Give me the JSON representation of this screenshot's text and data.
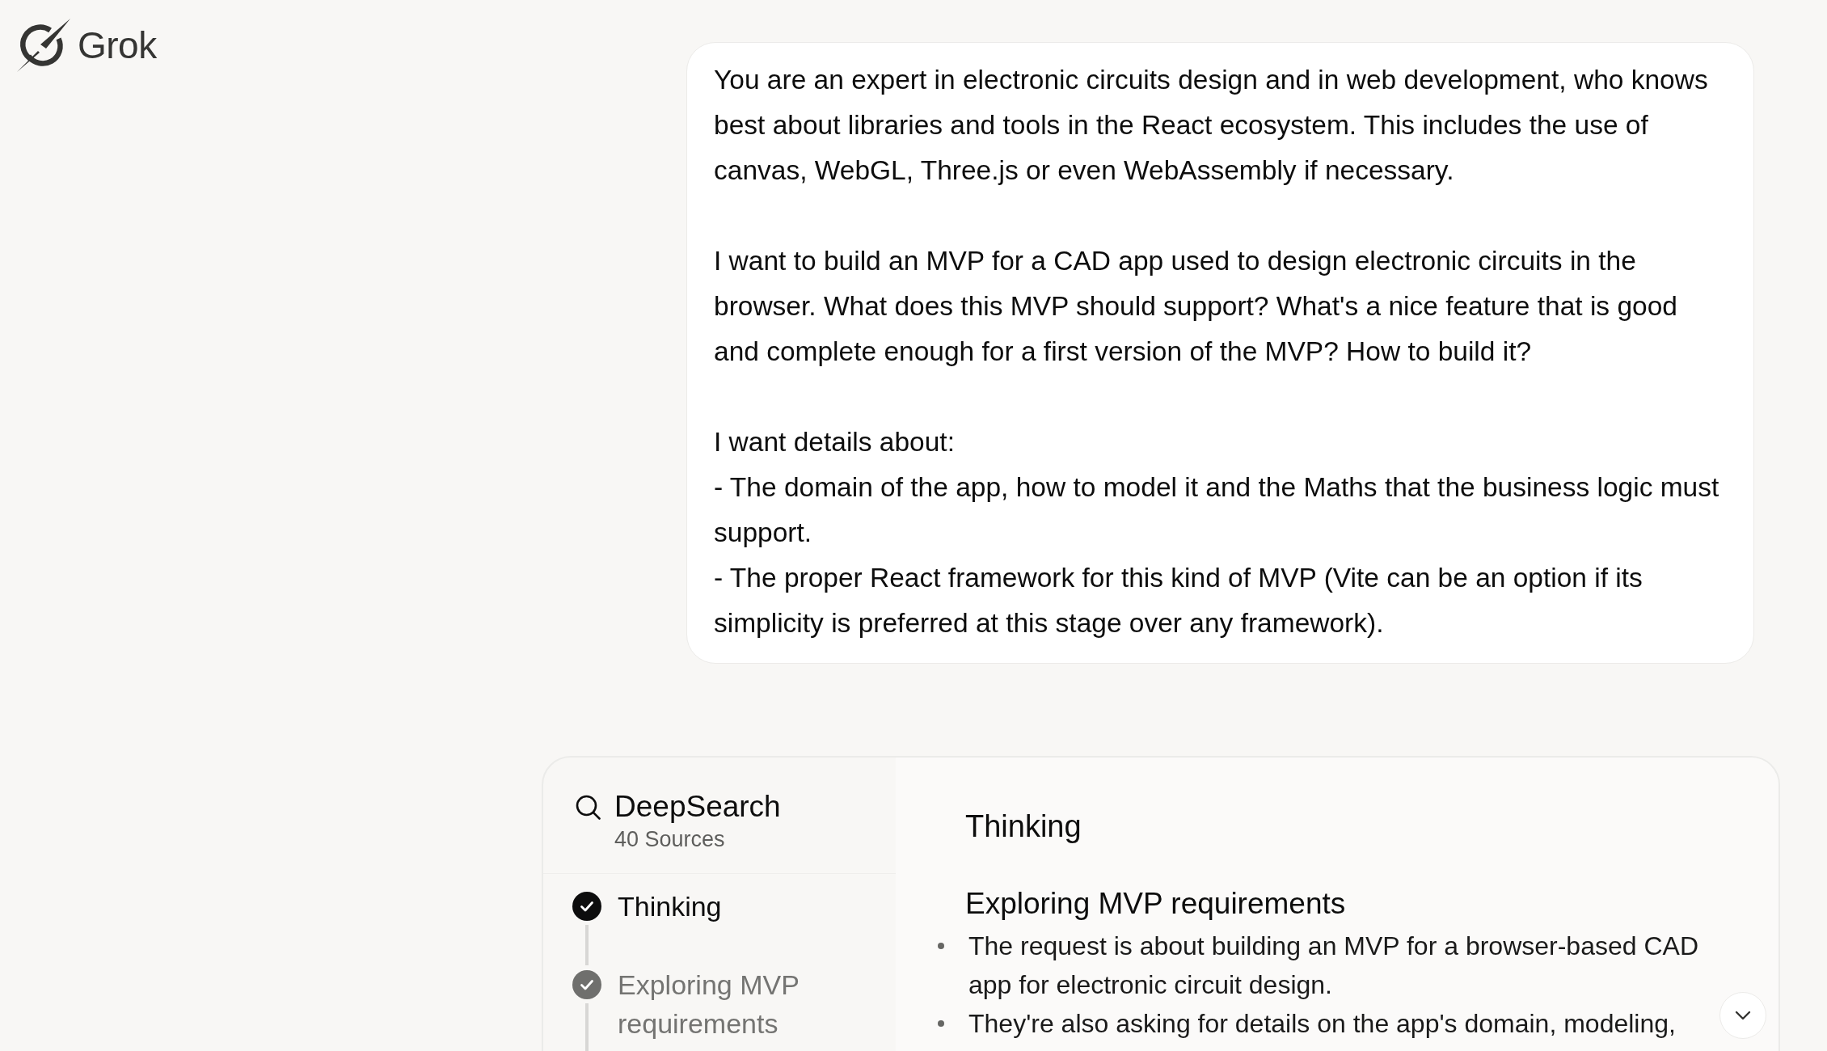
{
  "logo": {
    "text": "Grok"
  },
  "message": {
    "paragraphs": [
      "You are an expert in electronic circuits design and in web development, who knows best about libraries and tools in the React ecosystem. This includes the use of canvas, WebGL, Three.js or even WebAssembly if necessary.",
      "I want to build an MVP for a CAD app used to design electronic circuits in the browser. What does this MVP should support? What's a nice feature that is good and complete enough for a first version of the MVP? How to build it?",
      "I want details about:\n- The domain of the app, how to model it and the Maths that the business logic must support.\n- The proper React framework for this kind of MVP (Vite can be an option if its simplicity is preferred at this stage over any framework)."
    ]
  },
  "deepsearch": {
    "title": "DeepSearch",
    "sources": "40 Sources",
    "steps": [
      {
        "label": "Thinking",
        "selected": true,
        "completed": true
      },
      {
        "label": "Exploring MVP requirements",
        "selected": false,
        "completed": true
      }
    ]
  },
  "thinking_pane": {
    "title": "Thinking",
    "sections": [
      {
        "heading": "Exploring MVP requirements",
        "bullets": [
          "The request is about building an MVP for a browser-based CAD app for electronic circuit design.",
          "They're also asking for details on the app's domain, modeling,"
        ]
      }
    ]
  }
}
